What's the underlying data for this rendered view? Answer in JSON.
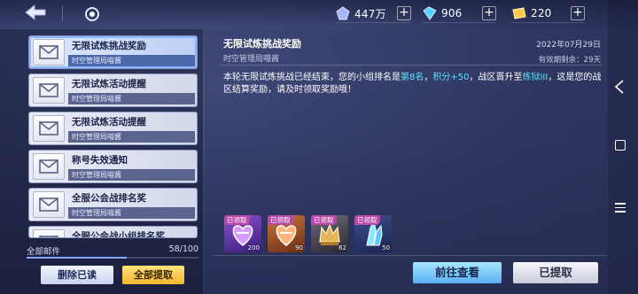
{
  "currencies": [
    {
      "name": "gem-currency",
      "value": "447万",
      "plus": "+"
    },
    {
      "name": "crystal-currency",
      "value": "906",
      "plus": "+"
    },
    {
      "name": "gold-currency",
      "value": "220",
      "plus": "+"
    }
  ],
  "mail_list": [
    {
      "title": "无限试炼挑战奖励",
      "sender": "时空管理局喵酱"
    },
    {
      "title": "无限试炼活动提醒",
      "sender": "时空管理局喵酱"
    },
    {
      "title": "无限试炼活动提醒",
      "sender": "时空管理局喵酱"
    },
    {
      "title": "称号失效通知",
      "sender": "时空管理局喵酱"
    },
    {
      "title": "全服公会战排名奖",
      "sender": "时空管理局喵酱"
    },
    {
      "title": "全服公会战小组排名奖",
      "sender": ""
    }
  ],
  "mail_footer": {
    "label": "全部邮件",
    "count": "58/100",
    "used_fraction": 0.58
  },
  "left_buttons": {
    "delete_read": "删除已读",
    "claim_all": "全部提取"
  },
  "mail_detail": {
    "title": "无限试炼挑战奖励",
    "date": "2022年07月29日",
    "sender": "时空管理局喵酱",
    "expire": "有效期剩余：29天",
    "body": {
      "p1": "本轮无限试炼挑战已经结束，您的小组排名是",
      "rank": "第8名",
      "p2": "，",
      "points": "积分+50",
      "p3": "，战区晋升至",
      "division": "炼狱III",
      "p4": "，这是您的战区结算奖励，请及时领取奖励哦！"
    }
  },
  "rewards": [
    {
      "status": "已领取",
      "qty": "200",
      "icon": "purple-heart-item"
    },
    {
      "status": "已领取",
      "qty": "90",
      "icon": "orange-heart-item"
    },
    {
      "status": "已领取",
      "qty": "62",
      "icon": "crown-badge-item"
    },
    {
      "status": "已领取",
      "qty": "50",
      "icon": "blue-crystal-item"
    }
  ],
  "action_buttons": {
    "goto": "前往查看",
    "claimed": "已提取"
  },
  "colors": {
    "highlight": "#59e3ff",
    "claim_all_bg": "#f2b530",
    "goto_bg": "#5ab0f0",
    "claimed_tag": "#b94aa8"
  }
}
